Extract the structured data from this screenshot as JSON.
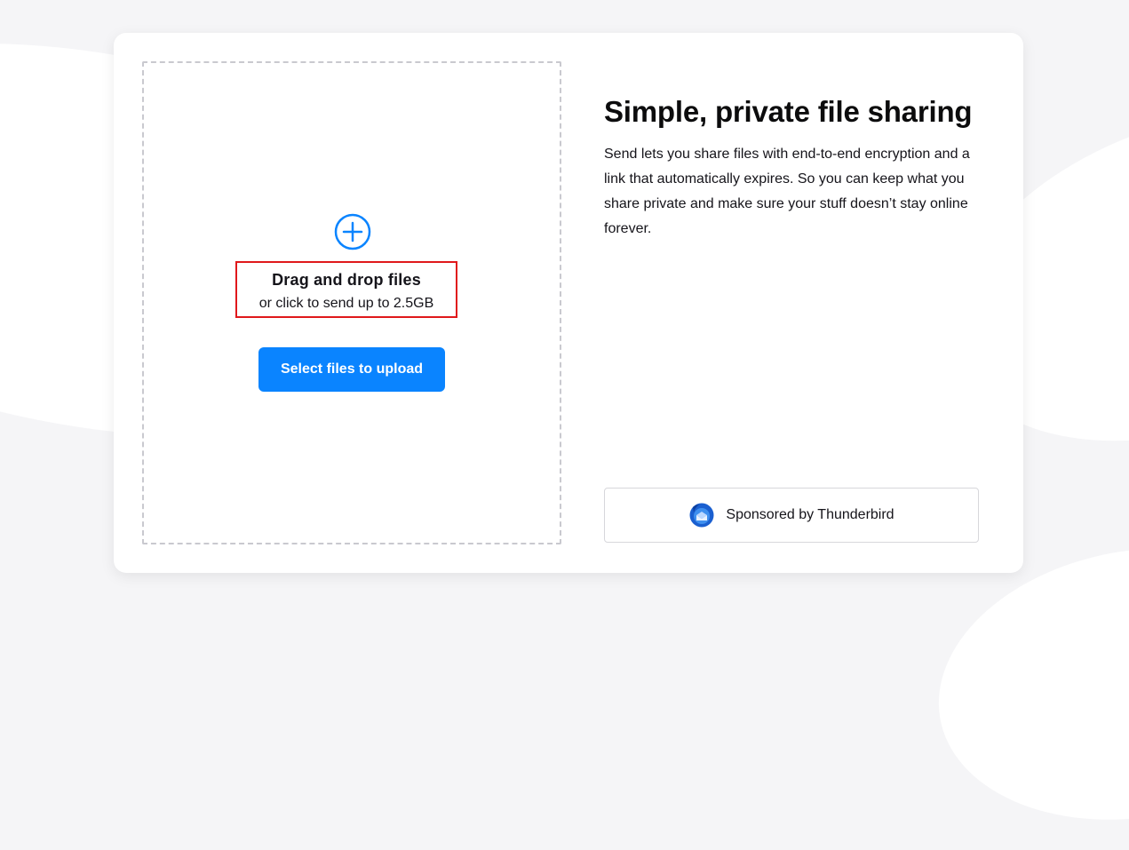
{
  "colors": {
    "accent": "#0a84ff",
    "highlight_border": "#e0181b",
    "page_background": "#f5f5f7"
  },
  "upload": {
    "icon": "plus-circle-icon",
    "title": "Drag and drop files",
    "subtitle": "or click to send up to 2.5GB",
    "button_label": "Select files to upload"
  },
  "intro": {
    "heading": "Simple, private file sharing",
    "description": "Send lets you share files with end-to-end encryption and a link that automatically expires. So you can keep what you share private and make sure your stuff doesn’t stay online forever."
  },
  "sponsor": {
    "icon": "thunderbird-logo-icon",
    "label": "Sponsored by Thunderbird"
  }
}
